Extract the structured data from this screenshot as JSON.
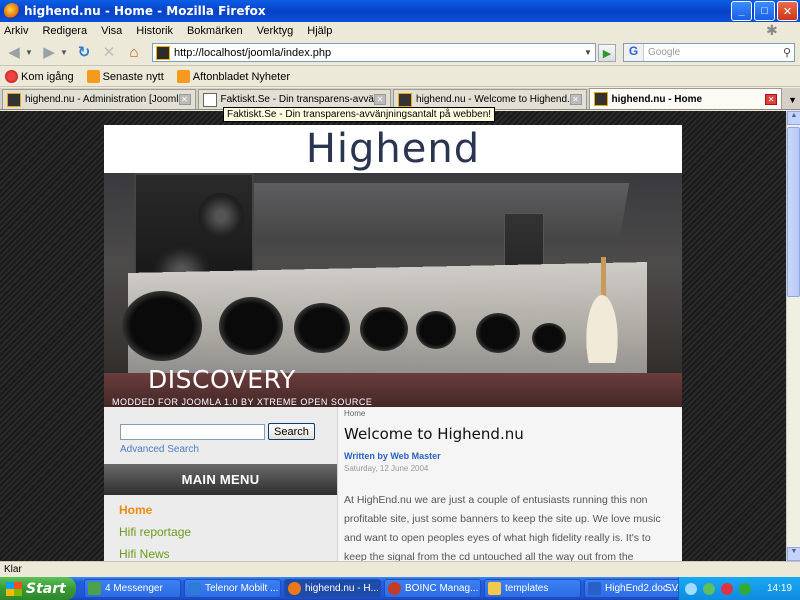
{
  "window": {
    "title": "highend.nu - Home - Mozilla Firefox",
    "minimize": "_",
    "maximize": "□",
    "close": "✕"
  },
  "menubar": [
    "Arkiv",
    "Redigera",
    "Visa",
    "Historik",
    "Bokmärken",
    "Verktyg",
    "Hjälp"
  ],
  "navbar": {
    "url": "http://localhost/joomla/index.php",
    "search_placeholder": "Google",
    "search_engine": "G"
  },
  "bookmarks": [
    {
      "label": "Kom igång",
      "icon": "firefox-icon"
    },
    {
      "label": "Senaste nytt",
      "icon": "rss-icon"
    },
    {
      "label": "Aftonbladet Nyheter",
      "icon": "rss-icon"
    }
  ],
  "tabs": [
    {
      "label": "highend.nu - Administration [Joomla!]",
      "active": false
    },
    {
      "label": "Faktiskt.Se - Din transparens-avvänjni...",
      "active": false
    },
    {
      "label": "highend.nu - Welcome to Highend.nu",
      "active": false
    },
    {
      "label": "highend.nu - Home",
      "active": true
    }
  ],
  "tooltip": "Faktiskt.Se - Din transparens-avvänjningsantalt på webben!",
  "site": {
    "logo": "Highend",
    "hero_caption": "DISCOVERY",
    "hero_subcaption": "MODDED FOR JOOMLA 1.0 BY XTREME OPEN SOURCE",
    "search_button": "Search",
    "search_value": "",
    "advanced_search": "Advanced Search",
    "main_menu_title": "MAIN MENU",
    "menu_items": [
      "Home",
      "Hifi reportage",
      "Hifi News"
    ],
    "breadcrumb": "Home",
    "article_title": "Welcome to Highend.nu",
    "written_by": "Written by Web Master",
    "date": "Saturday, 12 June 2004",
    "body": "At HighEnd.nu we are just a couple of entusiasts running this non profitable site, just some banners to keep the site up. We love music and want to open peoples eyes of what high fidelity really is. It's to keep the signal from the cd untouched all the way out from the speakers until it"
  },
  "status": "Klar",
  "taskbar": {
    "start": "Start",
    "tasks": [
      {
        "label": "4 Messenger",
        "color": "#4aa14a"
      },
      {
        "label": "Telenor Mobilt ...",
        "color": "#2d7bd9"
      },
      {
        "label": "highend.nu - H...",
        "color": "#e87a1c"
      },
      {
        "label": "BOINC Manag...",
        "color": "#c23c2a"
      },
      {
        "label": "templates",
        "color": "#f2c94c"
      },
      {
        "label": "HighEnd2.doc ...",
        "color": "#2b5fc8"
      }
    ],
    "language": "SV",
    "clock": "14:19"
  },
  "colors": {
    "menu_active": "#e98b12",
    "menu_item": "#6b9a1a",
    "link": "#2b62c2"
  }
}
